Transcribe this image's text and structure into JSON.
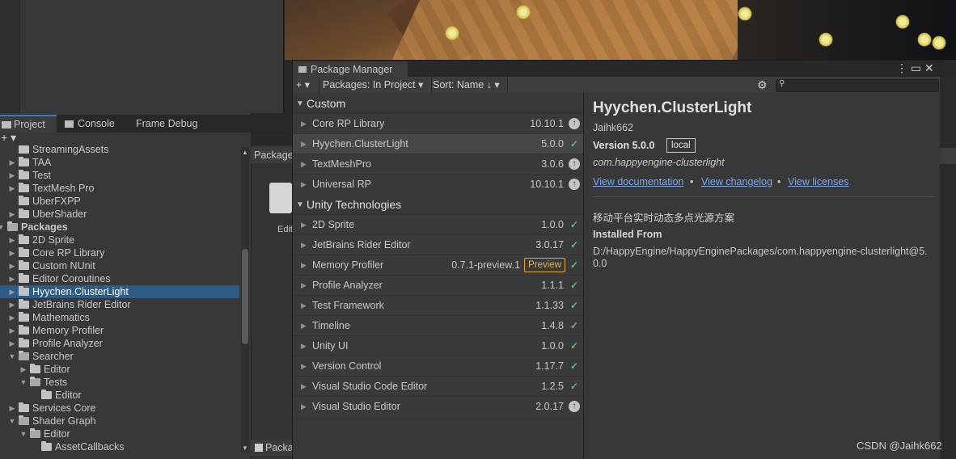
{
  "project_window": {
    "tabs": [
      "Project",
      "Console",
      "Frame Debug"
    ],
    "tree": [
      {
        "label": "StreamingAssets",
        "indent": 1,
        "arrow": "",
        "open": false
      },
      {
        "label": "TAA",
        "indent": 1,
        "arrow": "▶",
        "open": false
      },
      {
        "label": "Test",
        "indent": 1,
        "arrow": "▶",
        "open": false
      },
      {
        "label": "TextMesh Pro",
        "indent": 1,
        "arrow": "▶",
        "open": false
      },
      {
        "label": "UberFXPP",
        "indent": 1,
        "arrow": "",
        "open": false
      },
      {
        "label": "UberShader",
        "indent": 1,
        "arrow": "▶",
        "open": false
      },
      {
        "label": "Packages",
        "indent": 0,
        "arrow": "▼",
        "open": true,
        "bold": true
      },
      {
        "label": "2D Sprite",
        "indent": 1,
        "arrow": "▶",
        "open": false
      },
      {
        "label": "Core RP Library",
        "indent": 1,
        "arrow": "▶",
        "open": false
      },
      {
        "label": "Custom NUnit",
        "indent": 1,
        "arrow": "▶",
        "open": false
      },
      {
        "label": "Editor Coroutines",
        "indent": 1,
        "arrow": "▶",
        "open": false
      },
      {
        "label": "Hyychen.ClusterLight",
        "indent": 1,
        "arrow": "▶",
        "open": false,
        "selected": true
      },
      {
        "label": "JetBrains Rider Editor",
        "indent": 1,
        "arrow": "▶",
        "open": false
      },
      {
        "label": "Mathematics",
        "indent": 1,
        "arrow": "▶",
        "open": false
      },
      {
        "label": "Memory Profiler",
        "indent": 1,
        "arrow": "▶",
        "open": false
      },
      {
        "label": "Profile Analyzer",
        "indent": 1,
        "arrow": "▶",
        "open": false
      },
      {
        "label": "Searcher",
        "indent": 1,
        "arrow": "▼",
        "open": true
      },
      {
        "label": "Editor",
        "indent": 2,
        "arrow": "▶",
        "open": false
      },
      {
        "label": "Tests",
        "indent": 2,
        "arrow": "▼",
        "open": true
      },
      {
        "label": "Editor",
        "indent": 3,
        "arrow": "",
        "open": false
      },
      {
        "label": "Services Core",
        "indent": 1,
        "arrow": "▶",
        "open": false
      },
      {
        "label": "Shader Graph",
        "indent": 1,
        "arrow": "▼",
        "open": true
      },
      {
        "label": "Editor",
        "indent": 2,
        "arrow": "▼",
        "open": true
      },
      {
        "label": "AssetCallbacks",
        "indent": 3,
        "arrow": "",
        "open": false
      }
    ],
    "assets_header": "Package",
    "asset_label": "Edit",
    "assets_footer": "Packa"
  },
  "package_manager": {
    "title": "Package Manager",
    "toolbar": {
      "add": "+ ▾",
      "filter": "Packages: In Project ▾",
      "sort": "Sort: Name ↓ ▾",
      "gear": "⚙",
      "search_icon": "⚲",
      "search_placeholder": ""
    },
    "window_controls": "⋮ ▭ ✕",
    "groups": [
      {
        "name": "Custom",
        "packages": [
          {
            "name": "Core RP Library",
            "version": "10.10.1",
            "status": "update"
          },
          {
            "name": "Hyychen.ClusterLight",
            "version": "5.0.0",
            "status": "installed",
            "selected": true
          },
          {
            "name": "TextMeshPro",
            "version": "3.0.6",
            "status": "update"
          },
          {
            "name": "Universal RP",
            "version": "10.10.1",
            "status": "update"
          }
        ]
      },
      {
        "name": "Unity Technologies",
        "packages": [
          {
            "name": "2D Sprite",
            "version": "1.0.0",
            "status": "installed"
          },
          {
            "name": "JetBrains Rider Editor",
            "version": "3.0.17",
            "status": "installed"
          },
          {
            "name": "Memory Profiler",
            "version": "0.7.1-preview.1",
            "status": "installed",
            "tag": "Preview"
          },
          {
            "name": "Profile Analyzer",
            "version": "1.1.1",
            "status": "installed"
          },
          {
            "name": "Test Framework",
            "version": "1.1.33",
            "status": "installed"
          },
          {
            "name": "Timeline",
            "version": "1.4.8",
            "status": "installed"
          },
          {
            "name": "Unity UI",
            "version": "1.0.0",
            "status": "installed"
          },
          {
            "name": "Version Control",
            "version": "1.17.7",
            "status": "installed"
          },
          {
            "name": "Visual Studio Code Editor",
            "version": "1.2.5",
            "status": "installed"
          },
          {
            "name": "Visual Studio Editor",
            "version": "2.0.17",
            "status": "update"
          }
        ]
      }
    ],
    "detail": {
      "title": "Hyychen.ClusterLight",
      "author": "Jaihk662",
      "version_label": "Version 5.0.0",
      "source_badge": "local",
      "package_id": "com.happyengine-clusterlight",
      "links": [
        "View documentation",
        "View changelog",
        "View licenses"
      ],
      "link_separator": "•",
      "description": "移动平台实时动态多点光源方案",
      "installed_from_heading": "Installed From",
      "installed_from_path": "D:/HappyEngine/HappyEnginePackages/com.happyengine-clusterlight@5.0.0"
    }
  },
  "watermark": "CSDN @Jaihk662",
  "colors": {
    "selection": "#2c5d87",
    "installed_check": "#5fbf6b",
    "preview_tag": "#e0a83a",
    "link": "#7fa9e8"
  }
}
